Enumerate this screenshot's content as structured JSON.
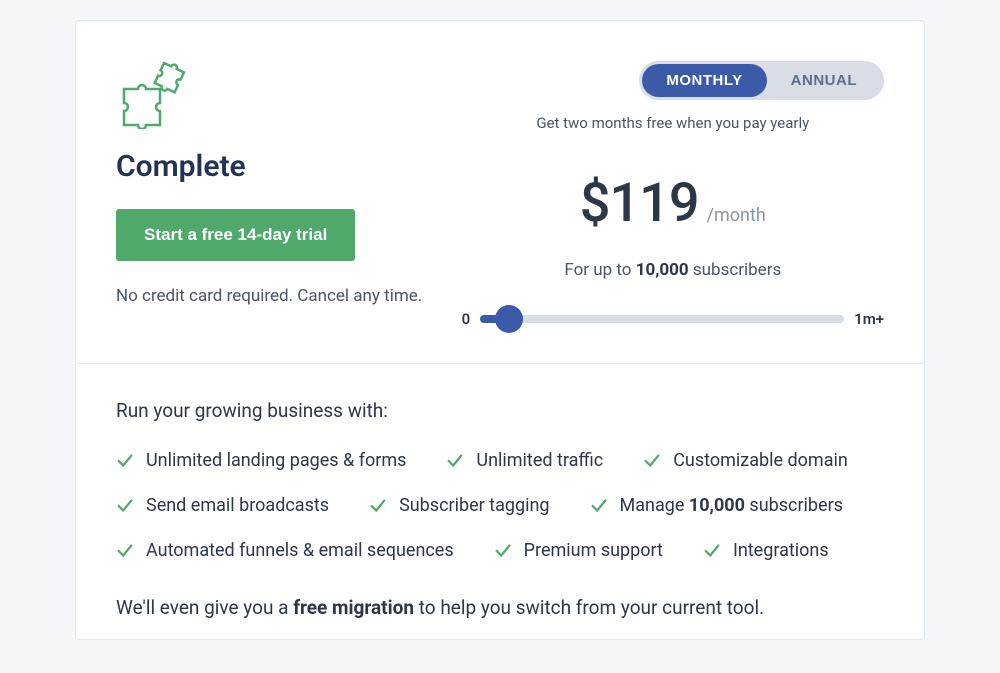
{
  "plan": {
    "title": "Complete",
    "trial_button": "Start a free 14-day trial",
    "no_cc_text": "No credit card required. Cancel any time."
  },
  "billing": {
    "monthly_label": "MONTHLY",
    "annual_label": "ANNUAL",
    "promo": "Get two months free when you pay yearly",
    "price": "$119",
    "per": "/month",
    "for_up_to_pre": "For up to ",
    "subscriber_count": "10,000",
    "for_up_to_post": " subscribers"
  },
  "slider": {
    "min_label": "0",
    "max_label": "1m+"
  },
  "features_intro": "Run your growing business with:",
  "features": {
    "f0": "Unlimited landing pages & forms",
    "f1": "Unlimited traffic",
    "f2": "Customizable domain",
    "f3": "Send email broadcasts",
    "f4": "Subscriber tagging",
    "f5_pre": "Manage ",
    "f5_bold": "10,000",
    "f5_post": " subscribers",
    "f6": "Automated funnels & email sequences",
    "f7": "Premium support",
    "f8": "Integrations"
  },
  "migration": {
    "pre": "We'll even give you a ",
    "bold": "free migration",
    "post": " to help you switch from your current tool."
  }
}
